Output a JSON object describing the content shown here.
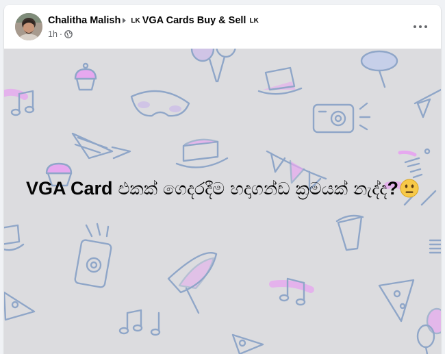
{
  "post": {
    "author": "Chalitha Malish",
    "flag_before": "LK",
    "group": "VGA Cards Buy & Sell",
    "flag_after": "LK",
    "time": "1h",
    "separator": "·",
    "privacy_icon": "globe-icon",
    "more_icon": "more-options-icon",
    "text_part1": "VGA Card",
    "text_part2": " එකක් ගෙදරදීම හදාගන්ඩ ක්‍රමයක් නැද්ද",
    "text_part3": "?",
    "emoji": "neutral-face-emoji"
  },
  "colors": {
    "text_primary": "#050505",
    "text_secondary": "#65676b",
    "background_pattern": "#dcdcdf",
    "pattern_stroke": "#8fa6c8",
    "pattern_accent": "#e6a8ef"
  }
}
